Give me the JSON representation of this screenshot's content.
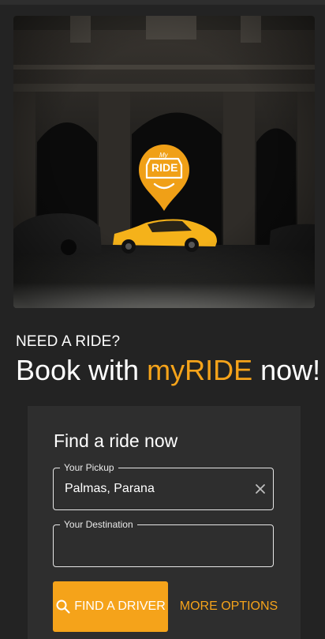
{
  "hero": {
    "logo_small_text": "My",
    "logo_text": "RIDE"
  },
  "tagline": "NEED A RIDE?",
  "headline": {
    "prefix": "Book with ",
    "brand": "myRIDE",
    "suffix": " now!"
  },
  "search_card": {
    "title": "Find a ride now",
    "pickup": {
      "label": "Your Pickup",
      "value": "Palmas, Parana"
    },
    "destination": {
      "label": "Your Destination",
      "value": ""
    },
    "find_driver_label": "FIND A DRIVER",
    "more_options_label": "MORE OPTIONS"
  },
  "colors": {
    "accent": "#f5a31a",
    "background": "#232323",
    "card": "#2e2e2e"
  },
  "icons": {
    "clear": "close-icon",
    "search": "search-icon",
    "logo": "location-pin-icon"
  }
}
